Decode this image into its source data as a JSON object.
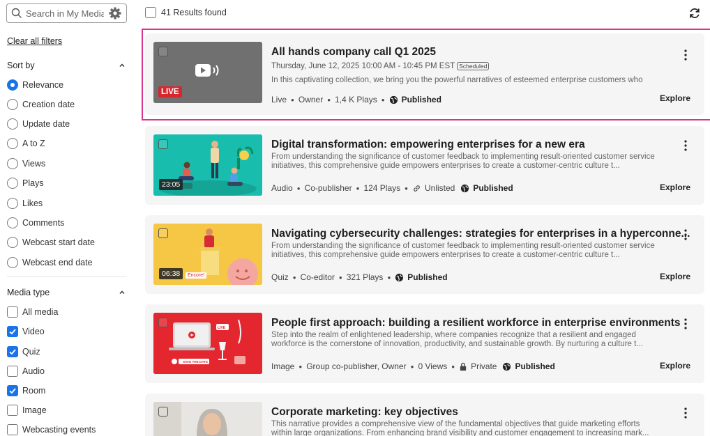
{
  "sidebar": {
    "search_placeholder": "Search in My Media",
    "clear_filters": "Clear all filters",
    "sort_by": {
      "title": "Sort by",
      "options": [
        "Relevance",
        "Creation date",
        "Update date",
        "A to Z",
        "Views",
        "Plays",
        "Likes",
        "Comments",
        "Webcast start date",
        "Webcast end date"
      ],
      "selected": "Relevance"
    },
    "media_type": {
      "title": "Media type",
      "options": [
        "All media",
        "Video",
        "Quiz",
        "Audio",
        "Room",
        "Image",
        "Webcasting events"
      ],
      "checked": [
        "Video",
        "Quiz",
        "Room"
      ]
    }
  },
  "results": {
    "count_label": "41 Results found"
  },
  "cards": [
    {
      "title": "All hands company call Q1 2025",
      "subtitle": "Thursday, June 12, 2025 10:00 AM - 10:45 PM EST",
      "badge": "Scheduled",
      "description": "In this captivating collection, we bring you the powerful narratives of esteemed enterprise customers who",
      "thumb_label": "LIVE",
      "meta": [
        "Live",
        "Owner",
        "1,4 K Plays"
      ],
      "status": "Published",
      "explore": "Explore"
    },
    {
      "title": "Digital transformation: empowering enterprises for a new era",
      "description": "From understanding the significance of customer feedback to implementing result-oriented customer service initiatives, this comprehensive guide empowers enterprises to create a customer-centric culture t...",
      "thumb_label": "23:05",
      "meta": [
        "Audio",
        "Co-publisher",
        "124 Plays"
      ],
      "visibility": "Unlisted",
      "status": "Published",
      "explore": "Explore"
    },
    {
      "title": "Navigating cybersecurity challenges: strategies for enterprises in a hyperconne...",
      "description": "From understanding the significance of customer feedback to implementing result-oriented customer service initiatives, this comprehensive guide empowers enterprises to create a customer-centric culture t...",
      "thumb_label": "06:38",
      "thumb_tag": "Encore!",
      "meta": [
        "Quiz",
        "Co-editor",
        "321 Plays"
      ],
      "status": "Published",
      "explore": "Explore"
    },
    {
      "title": "People first approach: building a resilient workforce in enterprise environments",
      "description": "Step into the realm of enlightened leadership, where companies recognize that a resilient and engaged workforce is the cornerstone of innovation, productivity, and sustainable growth. By nurturing a culture t...",
      "thumb_tags": [
        "LIVE",
        "SAVE THE DATE"
      ],
      "meta": [
        "Image",
        "Group co-publisher, Owner",
        "0 Views"
      ],
      "visibility": "Private",
      "status": "Published",
      "explore": "Explore"
    },
    {
      "title": "Corporate marketing: key objectives",
      "description": "This narrative provides a comprehensive view of the fundamental objectives that guide marketing efforts within large organizations. From enhancing brand visibility and customer engagement to increasing mark..."
    }
  ],
  "colors": {
    "accent": "#1a73e8",
    "highlight": "#d6348f",
    "live_badge": "#d7262e",
    "card_bg": "#f5f5f5"
  }
}
